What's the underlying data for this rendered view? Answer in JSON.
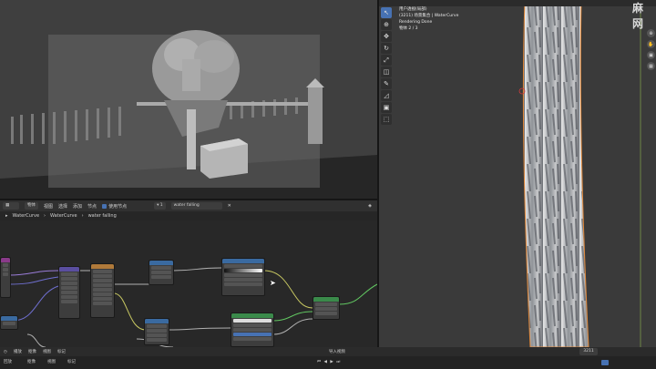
{
  "render_view": {
    "scene_desc": ""
  },
  "node_editor": {
    "header": {
      "editor_type": "物体",
      "menus": [
        "视图",
        "选择",
        "添加",
        "节点"
      ],
      "use_nodes": "使用节点",
      "slot": "1",
      "material": "water falling"
    },
    "breadcrumb": [
      "WaterCurve",
      "WaterCurve",
      "water falling"
    ]
  },
  "viewport3d": {
    "info_lines": [
      "用户透视(局部)",
      "(3211) 场景集合 | WaterCurve",
      "Rendering Done",
      "物体     2 / 3"
    ]
  },
  "watermark": "麻 网",
  "timeline": {
    "header_menus": [
      "播放",
      "抠像",
      "视图",
      "标记"
    ],
    "center_label": "导入视频",
    "frame_current": "3211",
    "tools": [
      "回放",
      "抠像",
      "视图",
      "标记"
    ]
  }
}
